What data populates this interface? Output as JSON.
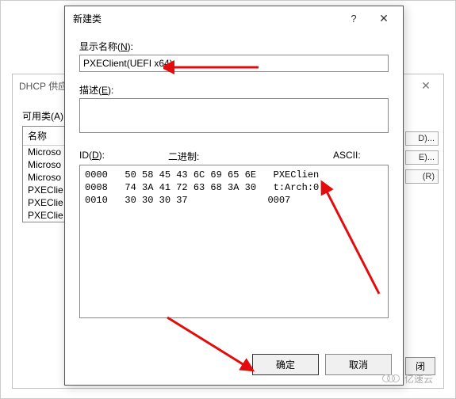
{
  "bg": {
    "title": "DHCP 供应",
    "close": "✕",
    "group_label": "可用类(A)",
    "col_name": "名称",
    "rows": [
      "Microso",
      "Microso",
      "Microso",
      "PXEClie",
      "PXEClie",
      "PXEClie"
    ],
    "side_buttons": [
      "D)...",
      "E)...",
      "(R)"
    ],
    "bottom_btn": "闭"
  },
  "modal": {
    "title": "新建类",
    "help": "?",
    "close": "✕",
    "display_name_pre": "显示名称(",
    "display_name_accel": "N",
    "display_name_post": "):",
    "display_name_value": "PXEClient(UEFI x64)",
    "desc_pre": "描述(",
    "desc_accel": "E",
    "desc_post": "):",
    "desc_value": "",
    "id_pre": "ID(",
    "id_accel": "D",
    "id_post": "):",
    "bin_label": "二进制:",
    "ascii_label": "ASCII:",
    "hex_lines": "0000   50 58 45 43 6C 69 65 6E   PXEClien\n0008   74 3A 41 72 63 68 3A 30   t:Arch:0\n0010   30 30 30 37              0007",
    "ok": "确定",
    "cancel": "取消"
  },
  "watermark": "亿速云"
}
